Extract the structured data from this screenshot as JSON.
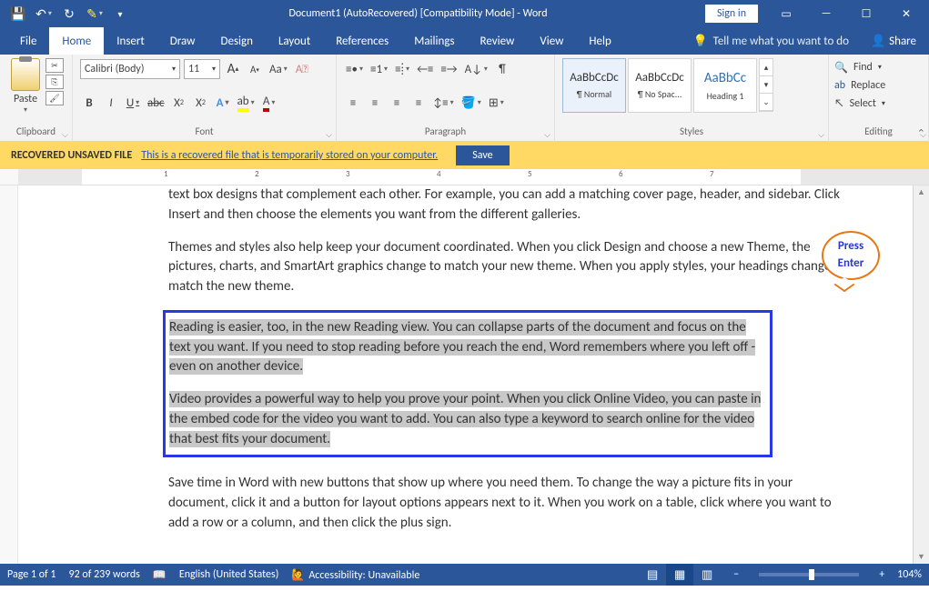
{
  "title": "Document1 (AutoRecovered) [Compatibility Mode]  -  Word",
  "signin": "Sign in",
  "tabs": {
    "file": "File",
    "home": "Home",
    "insert": "Insert",
    "draw": "Draw",
    "design": "Design",
    "layout": "Layout",
    "references": "References",
    "mailings": "Mailings",
    "review": "Review",
    "view": "View",
    "help": "Help"
  },
  "tellme": "Tell me what you want to do",
  "share": "Share",
  "groups": {
    "clipboard": "Clipboard",
    "font": "Font",
    "paragraph": "Paragraph",
    "styles": "Styles",
    "editing": "Editing"
  },
  "paste": "Paste",
  "font": {
    "name": "Calibri (Body)",
    "size": "11"
  },
  "style_items": [
    {
      "preview": "AaBbCcDc",
      "label": "¶ Normal"
    },
    {
      "preview": "AaBbCcDc",
      "label": "¶ No Spac..."
    },
    {
      "preview": "AaBbCc",
      "label": "Heading 1"
    }
  ],
  "editing": {
    "find": "Find",
    "replace": "Replace",
    "select": "Select"
  },
  "msgbar": {
    "label": "RECOVERED UNSAVED FILE",
    "text": "This is a recovered file that is temporarily stored on your computer.",
    "save": "Save"
  },
  "doc": {
    "p1": "text box designs that complement each other. For example, you can add a matching cover page, header, and sidebar. Click Insert and then choose the elements you want from the different galleries.",
    "p2": "Themes and styles also help keep your document coordinated. When you click Design and choose a new Theme, the pictures, charts, and SmartArt graphics change to match your new theme. When you apply styles, your headings change to match the new theme.",
    "p3": "Reading is easier, too, in the new Reading view. You can collapse parts of the document and focus on the text you want. If you need to stop reading before you reach the end, Word remembers where you left off - even on another device.",
    "p4": "Video provides a powerful way to help you prove your point. When you click Online Video, you can paste in the embed code for the video you want to add. You can also type a keyword to search online for the video that best fits your document.",
    "p5": "Save time in Word with new buttons that show up where you need them. To change the way a picture fits in your document, click it and a button for layout options appears next to it. When you work on a table, click where you want to add a row or a column, and then click the plus sign."
  },
  "callout": {
    "l1": "Press",
    "l2": "Enter"
  },
  "status": {
    "page": "Page 1 of 1",
    "words": "92 of 239 words",
    "lang": "English (United States)",
    "acc": "Accessibility: Unavailable",
    "zoom": "104%"
  }
}
